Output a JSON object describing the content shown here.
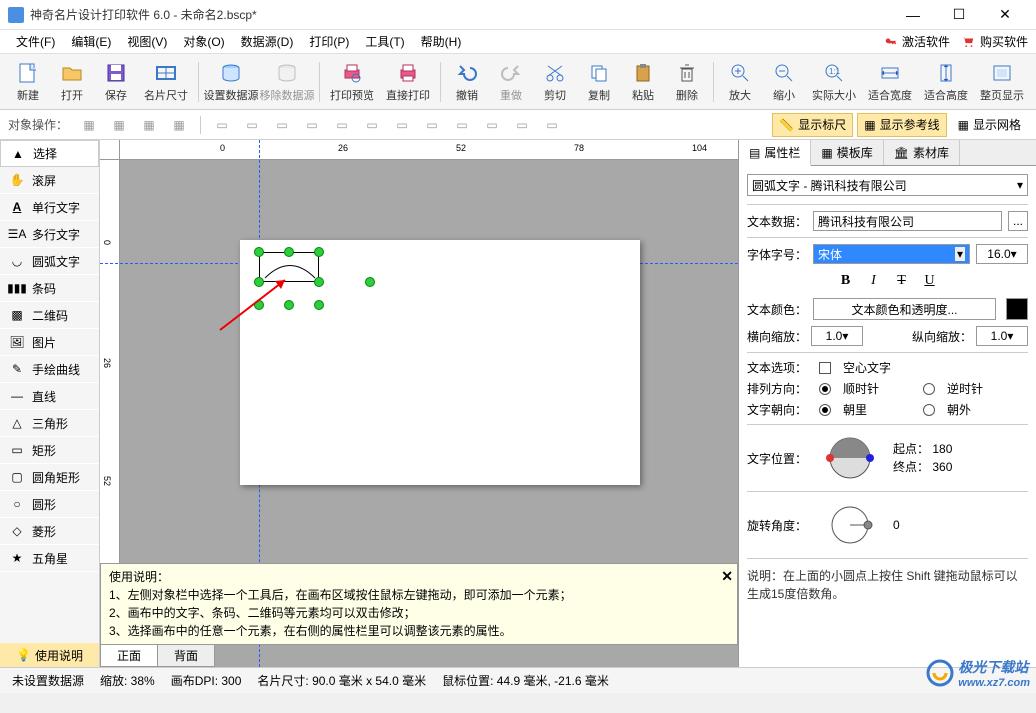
{
  "titlebar": {
    "title": "神奇名片设计打印软件 6.0 - 未命名2.bscp*"
  },
  "menubar": {
    "items": [
      "文件(F)",
      "编辑(E)",
      "视图(V)",
      "对象(O)",
      "数据源(D)",
      "打印(P)",
      "工具(T)",
      "帮助(H)"
    ],
    "activate": "激活软件",
    "buy": "购买软件"
  },
  "toolbar": {
    "groups": [
      [
        "新建",
        "打开",
        "保存",
        "名片尺寸"
      ],
      [
        "设置数据源",
        "移除数据源"
      ],
      [
        "打印预览",
        "直接打印"
      ],
      [
        "撤销",
        "重做",
        "剪切",
        "复制",
        "粘贴",
        "删除"
      ],
      [
        "放大",
        "缩小",
        "实际大小",
        "适合宽度",
        "适合高度",
        "整页显示"
      ]
    ]
  },
  "optbar": {
    "label": "对象操作：",
    "toggles": {
      "ruler": "显示标尺",
      "guides": "显示参考线",
      "grid": "显示网格"
    }
  },
  "left_tools": [
    "选择",
    "滚屏",
    "单行文字",
    "多行文字",
    "圆弧文字",
    "条码",
    "二维码",
    "图片",
    "手绘曲线",
    "直线",
    "三角形",
    "矩形",
    "圆角矩形",
    "圆形",
    "菱形",
    "五角星"
  ],
  "left_help": "使用说明",
  "ruler_h": [
    "0",
    "26",
    "52",
    "78",
    "104"
  ],
  "ruler_v": [
    "0",
    "26",
    "52"
  ],
  "bottom_tabs": {
    "front": "正面",
    "back": "背面"
  },
  "help_panel": {
    "title": "使用说明：",
    "lines": [
      "1、左侧对象栏中选择一个工具后，在画布区域按住鼠标左键拖动，即可添加一个元素；",
      "2、画布中的文字、条码、二维码等元素均可以双击修改；",
      "3、选择画布中的任意一个元素，在右侧的属性栏里可以调整该元素的属性。"
    ]
  },
  "right_panel": {
    "tabs": [
      "属性栏",
      "模板库",
      "素材库"
    ],
    "object_name": "圆弧文字 - 腾讯科技有限公司",
    "text_data_label": "文本数据：",
    "text_data_value": "腾讯科技有限公司",
    "font_label": "字体字号：",
    "font_name": "宋体",
    "font_size": "16.0",
    "format_btns": [
      "B",
      "I",
      "T",
      "U"
    ],
    "color_label": "文本颜色：",
    "color_btn": "文本颜色和透明度...",
    "hscale_label": "横向缩放：",
    "hscale": "1.0",
    "vscale_label": "纵向缩放：",
    "vscale": "1.0",
    "option_label": "文本选项：",
    "hollow": "空心文字",
    "dir_label": "排列方向：",
    "dir_cw": "顺时针",
    "dir_ccw": "逆时针",
    "orient_label": "文字朝向：",
    "orient_in": "朝里",
    "orient_out": "朝外",
    "pos_label": "文字位置：",
    "pos_start": "起点：",
    "pos_start_v": "180",
    "pos_end": "终点：",
    "pos_end_v": "360",
    "rot_label": "旋转角度：",
    "rot_value": "0",
    "note": "说明：在上面的小圆点上按住 Shift 键拖动鼠标可以生成15度倍数角。"
  },
  "statusbar": {
    "datasource": "未设置数据源",
    "zoom": "缩放: 38%",
    "dpi": "画布DPI: 300",
    "size": "名片尺寸: 90.0 毫米 x 54.0 毫米",
    "mouse": "鼠标位置: 44.9 毫米, -21.6 毫米"
  },
  "watermark": {
    "line1": "极光下载站",
    "line2": "www.xz7.com"
  }
}
